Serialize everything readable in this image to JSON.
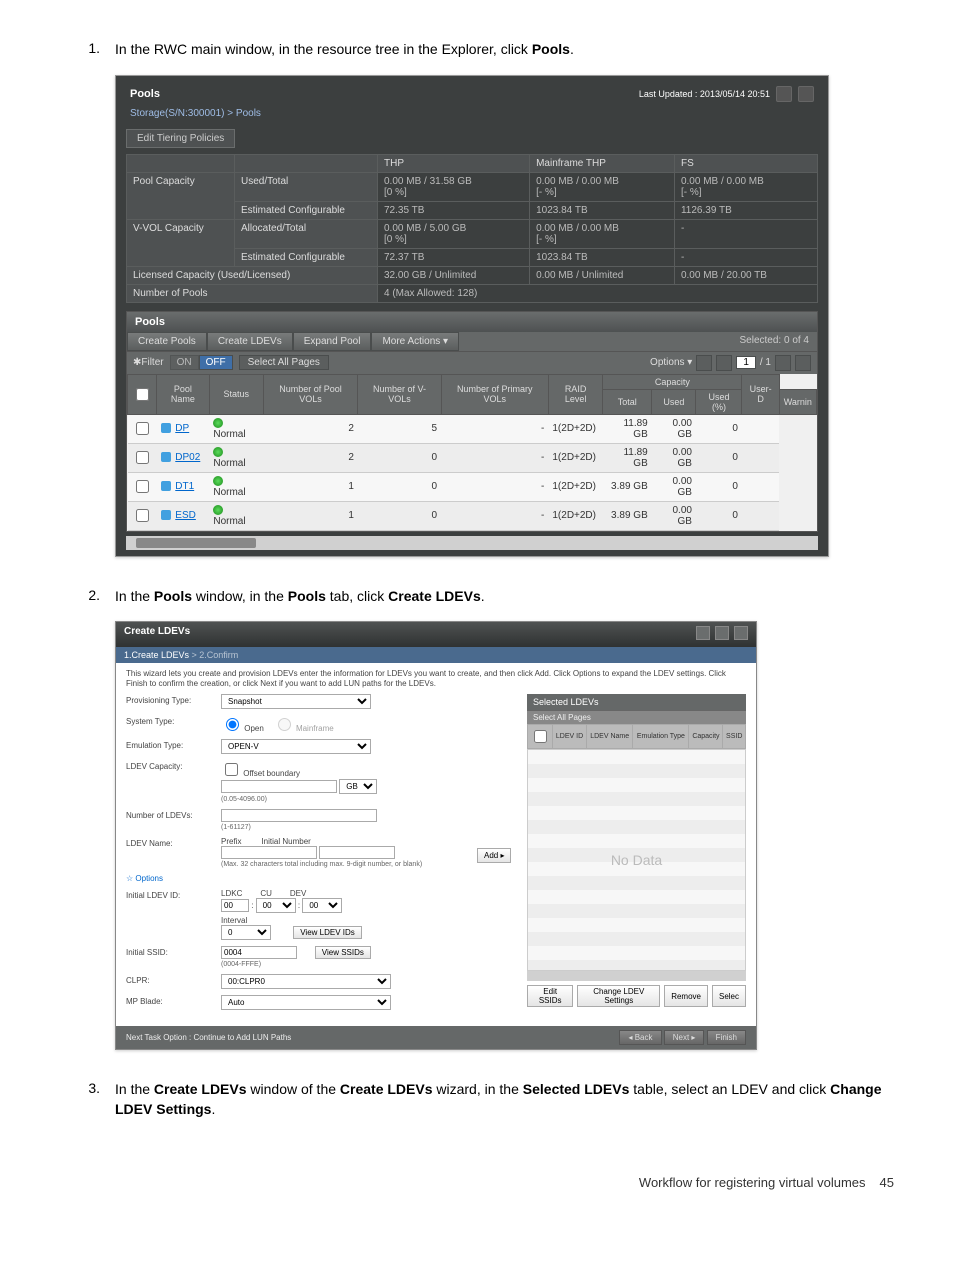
{
  "steps": {
    "s1": {
      "num": "1.",
      "text_before": "In the RWC main window, in the resource tree in the Explorer, click ",
      "text_bold": "Pools",
      "text_after": "."
    },
    "s2": {
      "num": "2.",
      "text_before": "In the ",
      "b1": "Pools",
      "mid1": " window, in the ",
      "b2": "Pools",
      "mid2": " tab, click ",
      "b3": "Create LDEVs",
      "text_after": "."
    },
    "s3": {
      "num": "3.",
      "text_before": "In the ",
      "b1": "Create LDEVs",
      "mid1": " window of the ",
      "b2": "Create LDEVs",
      "mid2": " wizard, in the ",
      "b3": "Selected LDEVs",
      "mid3": " table, select an LDEV and click ",
      "b4": "Change LDEV Settings",
      "text_after": "."
    }
  },
  "pools": {
    "title": "Pools",
    "last_updated": "Last Updated : 2013/05/14 20:51",
    "breadcrumb": "Storage(S/N:300001) > Pools",
    "edit_tiering": "Edit Tiering Policies",
    "summary": {
      "cols": {
        "c1": "",
        "c2": "THP",
        "c3": "Mainframe THP",
        "c4": "FS"
      },
      "rows": [
        {
          "r1": "Pool Capacity",
          "r2": "Used/Total",
          "thp": "0.00 MB / 31.58 GB",
          "thp2": "[0 %]",
          "mf": "0.00 MB / 0.00 MB",
          "mf2": "[- %]",
          "fs": "0.00 MB / 0.00 MB",
          "fs2": "[- %]"
        },
        {
          "r1": "",
          "r2": "Estimated Configurable",
          "thp": "72.35 TB",
          "mf": "1023.84 TB",
          "fs": "1126.39 TB"
        },
        {
          "r1": "V-VOL Capacity",
          "r2": "Allocated/Total",
          "thp": "0.00 MB / 5.00 GB",
          "thp2": "[0 %]",
          "mf": "0.00 MB / 0.00 MB",
          "mf2": "[- %]",
          "fs": "-"
        },
        {
          "r1": "",
          "r2": "Estimated Configurable",
          "thp": "72.37 TB",
          "mf": "1023.84 TB",
          "fs": "-"
        },
        {
          "r1": "Licensed Capacity (Used/Licensed)",
          "r2": "",
          "thp": "32.00 GB / Unlimited",
          "mf": "0.00 MB / Unlimited",
          "fs": "0.00 MB / 20.00 TB"
        },
        {
          "r1": "Number of Pools",
          "r2": "",
          "thp": "4 (Max Allowed: 128)",
          "mf": "",
          "fs": ""
        }
      ]
    },
    "sub_title": "Pools",
    "actions": {
      "create_pools": "Create Pools",
      "create_ldevs": "Create LDEVs",
      "expand_pool": "Expand Pool",
      "more": "More Actions",
      "selected": "Selected:  0  of  4"
    },
    "filter": {
      "label": "✱Filter",
      "on": "ON",
      "off": "OFF",
      "select_all": "Select All Pages",
      "options": "Options ▾",
      "page": "1",
      "pages": "/ 1"
    },
    "table": {
      "headers": {
        "chk": "",
        "name": "Pool Name",
        "status": "Status",
        "npv": "Number of\nPool VOLs",
        "nvv": "Number of\nV-VOLs",
        "npri": "Number of\nPrimary VOLs",
        "raid": "RAID\nLevel",
        "cap": "Capacity",
        "total": "Total",
        "used": "Used",
        "usedp": "Used (%)",
        "userd": "User-D",
        "warn": "Warnin"
      },
      "rows": [
        {
          "name": "DP",
          "status": "Normal",
          "npv": "2",
          "nvv": "5",
          "npri": "-",
          "raid": "1(2D+2D)",
          "total": "11.89 GB",
          "used": "0.00 GB",
          "usedp": "0"
        },
        {
          "name": "DP02",
          "status": "Normal",
          "npv": "2",
          "nvv": "0",
          "npri": "-",
          "raid": "1(2D+2D)",
          "total": "11.89 GB",
          "used": "0.00 GB",
          "usedp": "0"
        },
        {
          "name": "DT1",
          "status": "Normal",
          "npv": "1",
          "nvv": "0",
          "npri": "-",
          "raid": "1(2D+2D)",
          "total": "3.89 GB",
          "used": "0.00 GB",
          "usedp": "0"
        },
        {
          "name": "ESD",
          "status": "Normal",
          "npv": "1",
          "nvv": "0",
          "npri": "-",
          "raid": "1(2D+2D)",
          "total": "3.89 GB",
          "used": "0.00 GB",
          "usedp": "0"
        }
      ]
    }
  },
  "create": {
    "title": "Create LDEVs",
    "steps": "1.Create LDEVs",
    "steps2": " > 2.Confirm",
    "desc": "This wizard lets you create and provision LDEVs enter the information for LDEVs you want to create, and then click Add. Click Options to expand the LDEV settings. Click Finish to confirm the creation, or click Next if you want to add LUN paths for the LDEVs.",
    "form": {
      "prov_type_lbl": "Provisioning Type:",
      "prov_type_val": "Snapshot",
      "sys_type_lbl": "System Type:",
      "sys_open": "Open",
      "sys_mf": "Mainframe",
      "emu_lbl": "Emulation Type:",
      "emu_val": "OPEN-V",
      "cap_lbl": "LDEV Capacity:",
      "cap_chk": "Offset boundary",
      "cap_unit": "GB",
      "cap_hint": "(0.05-4096.00)",
      "num_lbl": "Number of LDEVs:",
      "num_hint": "(1-61127)",
      "name_lbl": "LDEV Name:",
      "name_prefix": "Prefix",
      "name_initial": "Initial Number",
      "name_hint": "(Max. 32 characters total including max. 9-digit number, or blank)",
      "options": "☆ Options",
      "init_id_lbl": "Initial LDEV ID:",
      "ldkc": "LDKC",
      "cu": "CU",
      "dev": "DEV",
      "ldkc_v": "00",
      "cu_v": "00",
      "dev_v": "00",
      "interval": "Interval",
      "interval_v": "0",
      "view_ldev": "View LDEV IDs",
      "ssid_lbl": "Initial SSID:",
      "ssid_v": "0004",
      "ssid_hint": "(0004-FFFE)",
      "view_ssid": "View SSIDs",
      "clpr_lbl": "CLPR:",
      "clpr_v": "00:CLPR0",
      "blade_lbl": "MP Blade:",
      "blade_v": "Auto"
    },
    "add": "Add ▸",
    "selected": {
      "title": "Selected LDEVs",
      "select_all": "Select All Pages",
      "cols": {
        "id": "LDEV\nID",
        "name": "LDEV\nName",
        "emu": "Emulation\nType",
        "cap": "Capacity",
        "ssid": "SSID"
      },
      "nodata": "No Data",
      "edit_ssids": "Edit SSIDs",
      "change": "Change LDEV Settings",
      "remove": "Remove",
      "select": "Selec"
    },
    "footer_opt": "Next Task Option : Continue to Add LUN Paths",
    "back": "◂ Back",
    "next": "Next ▸",
    "finish": "Finish"
  },
  "footer": {
    "text": "Workflow for registering virtual volumes",
    "page": "45"
  }
}
